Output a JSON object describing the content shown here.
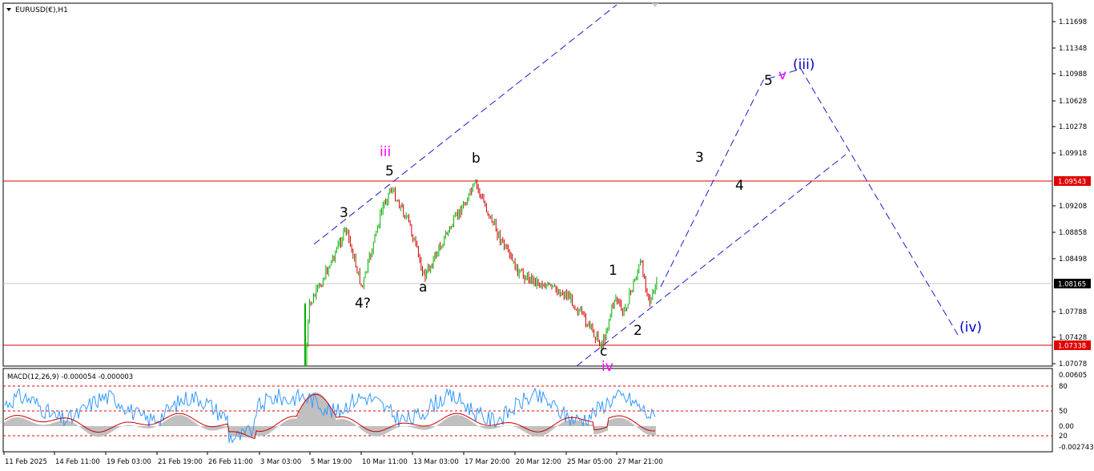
{
  "header": {
    "symbol_label": "EURUSD(€),H1",
    "menu_arrow_icon": "triangle-down-icon"
  },
  "indicator": {
    "label": "MACD(12,26,9) -0.000054 -0.000003",
    "axis_labels": [
      "0.00605",
      "80",
      "50",
      "20",
      "0.00",
      "-0.002743"
    ]
  },
  "price_axis_labels": [
    "1.11698",
    "1.11348",
    "1.10988",
    "1.10628",
    "1.10278",
    "1.09918",
    "1.09208",
    "1.08858",
    "1.08498",
    "1.07788",
    "1.07428",
    "1.07078"
  ],
  "price_badges": [
    {
      "text": "1.09543",
      "color": "#e00000"
    },
    {
      "text": "1.08165",
      "color": "#000000"
    },
    {
      "text": "1.07338",
      "color": "#e00000"
    }
  ],
  "time_axis_labels": [
    "11 Feb 2025",
    "14 Feb 11:00",
    "19 Feb 03:00",
    "21 Feb 19:00",
    "26 Feb 11:00",
    "3 Mar 03:00",
    "5 Mar 19:00",
    "10 Mar 11:00",
    "13 Mar 03:00",
    "17 Mar 20:00",
    "20 Mar 12:00",
    "25 Mar 05:00",
    "27 Mar 21:00"
  ],
  "wave_labels": [
    {
      "text": "iii",
      "color": "#ff00ff"
    },
    {
      "text": "5",
      "color": "#000000"
    },
    {
      "text": "3",
      "color": "#000000"
    },
    {
      "text": "4?",
      "color": "#000000"
    },
    {
      "text": "a",
      "color": "#000000"
    },
    {
      "text": "b",
      "color": "#000000"
    },
    {
      "text": "c",
      "color": "#000000"
    },
    {
      "text": "iv",
      "color": "#ff00ff"
    },
    {
      "text": "1",
      "color": "#000000"
    },
    {
      "text": "2",
      "color": "#000000"
    },
    {
      "text": "3",
      "color": "#000000"
    },
    {
      "text": "4",
      "color": "#000000"
    },
    {
      "text": "5",
      "color": "#000000"
    },
    {
      "text": "v",
      "color": "#ff00ff"
    },
    {
      "text": "(iii)",
      "color": "#0000cc"
    },
    {
      "text": "(iv)",
      "color": "#0000cc"
    }
  ],
  "colors": {
    "bull_candle": "#00b000",
    "bear_candle": "#d00000",
    "support_resistance": "#e00000",
    "projection": "#1a1acc",
    "macd_signal": "#3399ff",
    "macd_main": "#c80000",
    "histogram": "#c0c0c0"
  },
  "chart_data": {
    "type": "candlestick",
    "symbol": "EURUSD",
    "timeframe": "H1",
    "price_levels": {
      "resistance": 1.09543,
      "last": 1.08165,
      "support": 1.07338
    },
    "price_path": [
      {
        "time": "4 Mar",
        "price": 1.07
      },
      {
        "time": "5 Mar 19:00",
        "price": 1.0785
      },
      {
        "time": "6 Mar",
        "price": 1.0815
      },
      {
        "time": "7 Mar",
        "price": 1.089
      },
      {
        "time": "7 Mar late",
        "price": 1.081
      },
      {
        "time": "10 Mar 11:00",
        "price": 1.092
      },
      {
        "time": "11 Mar",
        "price": 1.0945
      },
      {
        "time": "12 Mar",
        "price": 1.09
      },
      {
        "time": "13 Mar 03:00",
        "price": 1.0825
      },
      {
        "time": "14 Mar",
        "price": 1.088
      },
      {
        "time": "17 Mar 20:00",
        "price": 1.095
      },
      {
        "time": "18 Mar",
        "price": 1.092
      },
      {
        "time": "19 Mar",
        "price": 1.086
      },
      {
        "time": "20 Mar 12:00",
        "price": 1.083
      },
      {
        "time": "24 Mar",
        "price": 1.08
      },
      {
        "time": "25 Mar 05:00",
        "price": 1.0733
      },
      {
        "time": "26 Mar",
        "price": 1.08
      },
      {
        "time": "26 Mar late",
        "price": 1.0775
      },
      {
        "time": "27 Mar",
        "price": 1.0845
      },
      {
        "time": "27 Mar 21:00",
        "price": 1.079
      },
      {
        "time": "28 Mar",
        "price": 1.0817
      }
    ],
    "macd_levels": [
      80,
      50,
      20
    ]
  }
}
